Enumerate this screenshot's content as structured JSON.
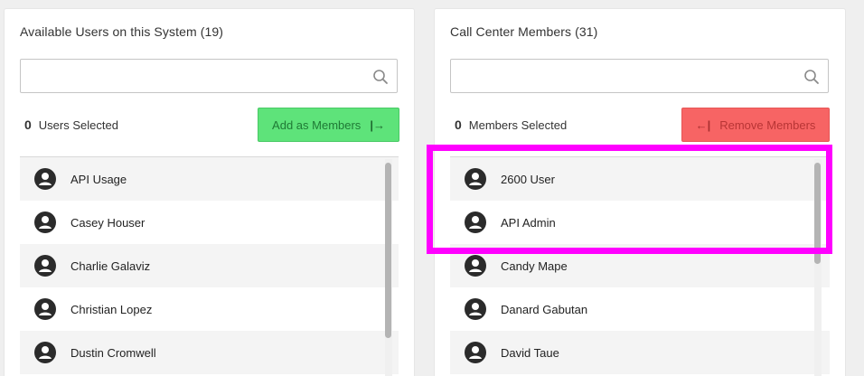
{
  "available_panel": {
    "title": "Available Users on this System (19)",
    "search": {
      "value": "",
      "placeholder": ""
    },
    "selected_count": "0",
    "selected_label": "Users Selected",
    "action_button": {
      "label": "Add as Members",
      "icon": "arrow-to-right-icon",
      "glyph": "|→"
    },
    "users": [
      {
        "name": "API Usage"
      },
      {
        "name": "Casey Houser"
      },
      {
        "name": "Charlie Galaviz"
      },
      {
        "name": "Christian Lopez"
      },
      {
        "name": "Dustin Cromwell"
      }
    ]
  },
  "members_panel": {
    "title": "Call Center Members (31)",
    "search": {
      "value": "",
      "placeholder": ""
    },
    "selected_count": "0",
    "selected_label": "Members Selected",
    "action_button": {
      "label": "Remove Members",
      "icon": "arrow-to-left-icon",
      "glyph": "←|"
    },
    "members": [
      {
        "name": "2600 User"
      },
      {
        "name": "API Admin"
      },
      {
        "name": "Candy Mape"
      },
      {
        "name": "Danard Gabutan"
      },
      {
        "name": "David Taue"
      }
    ]
  },
  "colors": {
    "add_button_bg": "#5ee37a",
    "remove_button_bg": "#f76464",
    "highlight": "#ff00ff",
    "avatar": "#2b2b2b"
  }
}
